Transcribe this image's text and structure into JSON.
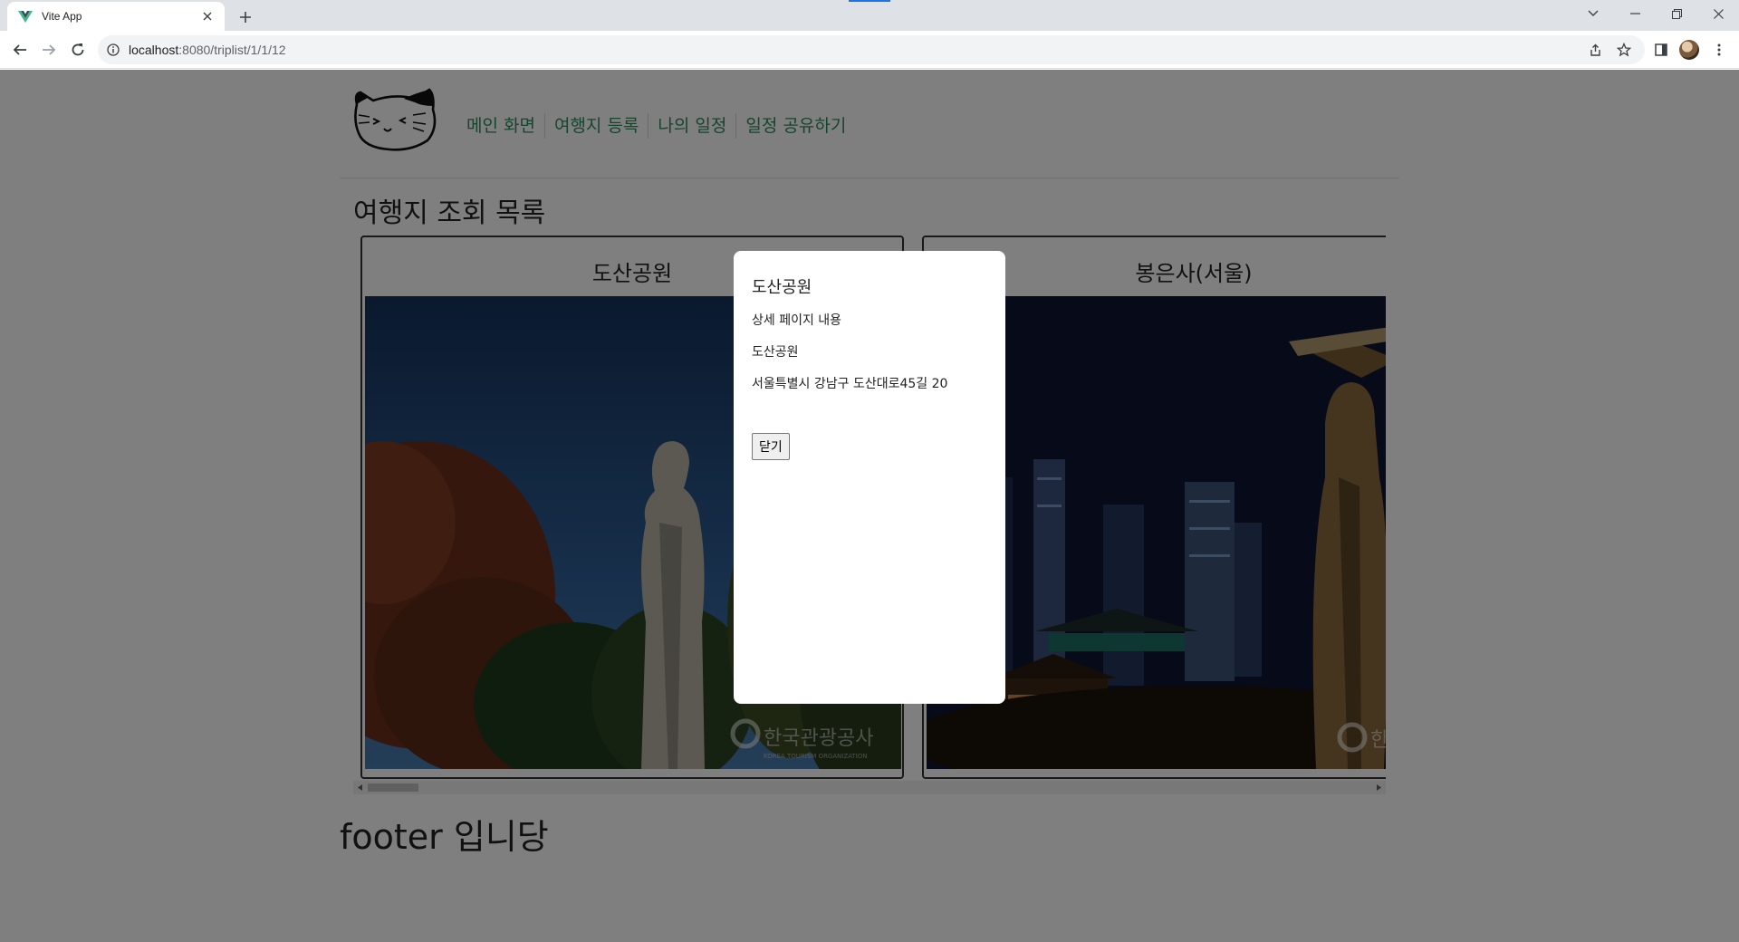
{
  "browser": {
    "tab_title": "Vite App",
    "url_host": "localhost",
    "url_rest": ":8080/triplist/1/1/12",
    "loading_color": "#1a73e8"
  },
  "site": {
    "nav": [
      "메인 화면",
      "여행지 등록",
      "나의 일정",
      "일정 공유하기"
    ],
    "nav_color": "#2c8a5c",
    "list_title": "여행지 조회 목록",
    "footer": "footer 입니당"
  },
  "cards": [
    {
      "title": "도산공원",
      "watermark": "한국관광공사",
      "watermark_sub": "KOREA TOURISM ORGANIZATION"
    },
    {
      "title": "봉은사(서울)",
      "watermark": "한국관광공사"
    }
  ],
  "modal": {
    "title": "도산공원",
    "subtitle": "상세 페이지 내용",
    "name": "도산공원",
    "address": "서울특별시 강남구 도산대로45길 20",
    "close_label": "닫기"
  },
  "icons": {
    "tab_favicon": "vue-logo-icon",
    "back": "back-arrow-icon",
    "forward": "forward-arrow-icon",
    "reload": "reload-icon",
    "site_info": "info-icon",
    "share": "share-icon",
    "bookmark": "star-icon",
    "side_panel": "side-panel-icon",
    "menu": "kebab-menu-icon"
  }
}
